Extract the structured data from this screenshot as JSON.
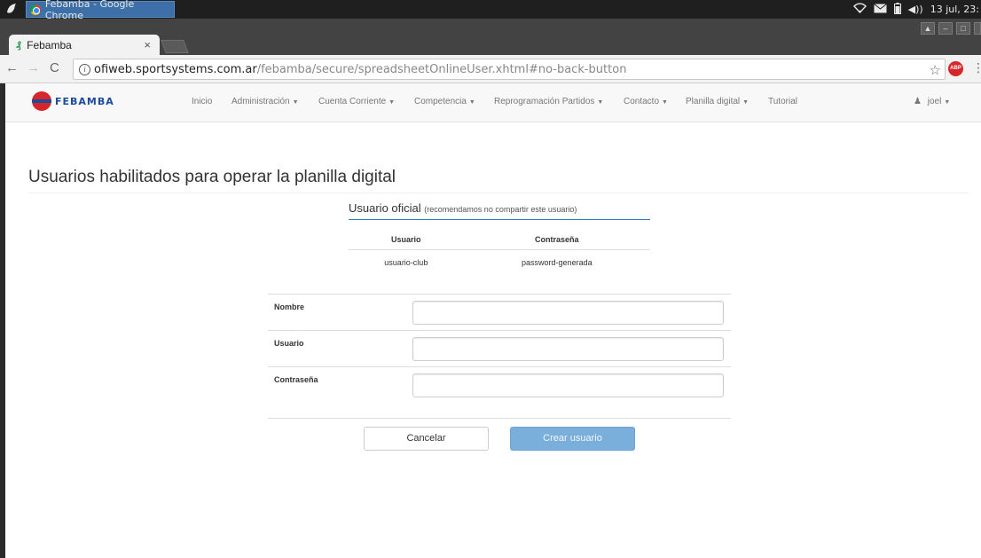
{
  "os": {
    "window_title": "Febamba - Google Chrome",
    "clock": "13 jul, 23:"
  },
  "browser": {
    "tab_title": "Febamba",
    "tab_favicon": "₰",
    "url_host": "ofiweb.sportsystems.com.ar",
    "url_path": "/febamba/secure/spreadsheetOnlineUser.xhtml#no-back-button"
  },
  "navbar": {
    "brand": "FEBAMBA",
    "items": [
      {
        "label": "Inicio",
        "dropdown": false
      },
      {
        "label": "Administración",
        "dropdown": true
      },
      {
        "label": "Cuenta Corriente",
        "dropdown": true
      },
      {
        "label": "Competencia",
        "dropdown": true
      },
      {
        "label": "Reprogramación Partidos",
        "dropdown": true
      },
      {
        "label": "Contacto",
        "dropdown": true
      },
      {
        "label": "Planilla digital",
        "dropdown": true
      },
      {
        "label": "Tutorial",
        "dropdown": false
      }
    ],
    "user": "joel"
  },
  "page": {
    "title": "Usuarios habilitados para operar la planilla digital"
  },
  "official": {
    "heading": "Usuario oficial",
    "note": "(recomendamos no compartir este usuario)",
    "headers": [
      "Usuario",
      "Contraseña"
    ],
    "row": [
      "usuario-club",
      "password-generada"
    ]
  },
  "form": {
    "fields": [
      {
        "label": "Nombre",
        "value": ""
      },
      {
        "label": "Usuario",
        "value": ""
      },
      {
        "label": "Contraseña",
        "value": ""
      }
    ],
    "cancel_label": "Cancelar",
    "create_label": "Crear usuario"
  }
}
